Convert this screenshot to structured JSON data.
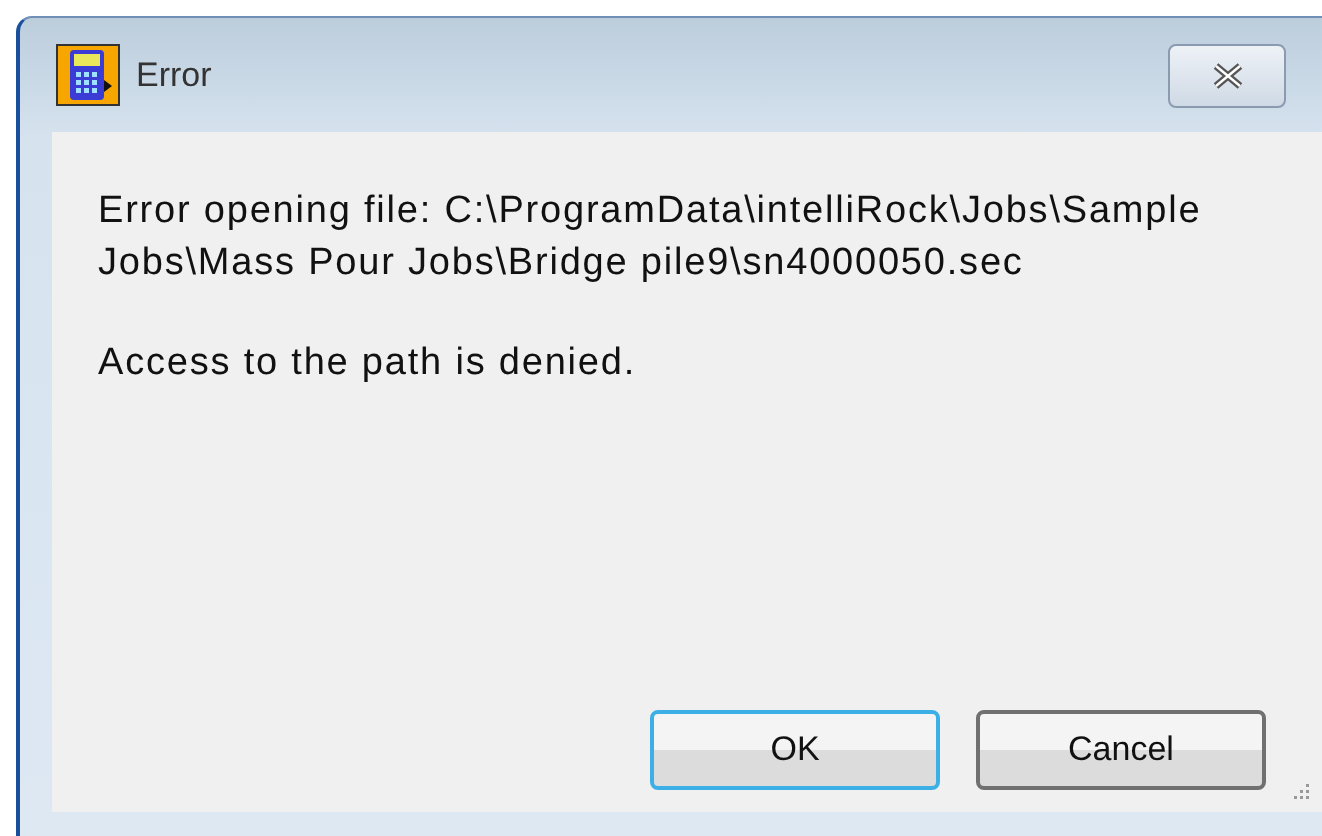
{
  "window": {
    "title": "Error"
  },
  "message": "Error opening file: C:\\ProgramData\\intelliRock\\Jobs\\Sample Jobs\\Mass Pour Jobs\\Bridge pile9\\sn4000050.sec",
  "detail": "Access to the path is denied.",
  "buttons": [
    {
      "label": "OK",
      "selected": true
    },
    {
      "label": "Cancel",
      "selected": false
    }
  ]
}
